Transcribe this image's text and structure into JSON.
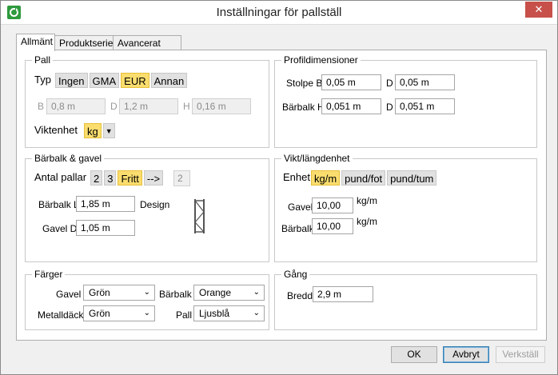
{
  "window": {
    "title": "Inställningar för pallställ",
    "close": "✕"
  },
  "tabs": [
    "Allmänt",
    "Produktserie",
    "Avancerat"
  ],
  "pall": {
    "title": "Pall",
    "typ_label": "Typ",
    "typ_options": [
      "Ingen",
      "GMA",
      "EUR",
      "Annan"
    ],
    "typ_selected": "EUR",
    "b_label": "B",
    "b_value": "0,8 m",
    "d_label": "D",
    "d_value": "1,2 m",
    "h_label": "H",
    "h_value": "0,16 m",
    "viktenhet_label": "Viktenhet",
    "viktenhet_value": "kg"
  },
  "profil": {
    "title": "Profildimensioner",
    "stolpe_label": "Stolpe B",
    "stolpe_b": "0,05 m",
    "stolpe_d_label": "D",
    "stolpe_d": "0,05 m",
    "barbalk_label": "Bärbalk H",
    "barbalk_h": "0,051 m",
    "barbalk_d_label": "D",
    "barbalk_d": "0,051 m"
  },
  "barbalk_gavel": {
    "title": "Bärbalk & gavel",
    "antal_label": "Antal pallar",
    "antal_options": [
      "2",
      "3",
      "Fritt",
      "-->"
    ],
    "antal_selected": "Fritt",
    "antal_value": "2",
    "barbalk_l_label": "Bärbalk L",
    "barbalk_l": "1,85 m",
    "design_label": "Design",
    "gavel_d_label": "Gavel D",
    "gavel_d": "1,05 m"
  },
  "vikt": {
    "title": "Vikt/längdenhet",
    "enhet_label": "Enhet",
    "enhet_options": [
      "kg/m",
      "pund/fot",
      "pund/tum"
    ],
    "enhet_selected": "kg/m",
    "gavel_label": "Gavel",
    "gavel_value": "10,00",
    "gavel_unit": "kg/m",
    "barbalk_label": "Bärbalk",
    "barbalk_value": "10,00",
    "barbalk_unit": "kg/m"
  },
  "farger": {
    "title": "Färger",
    "gavel_label": "Gavel",
    "gavel_value": "Grön",
    "barbalk_label": "Bärbalk",
    "barbalk_value": "Orange",
    "metalldack_label": "Metalldäck",
    "metalldack_value": "Grön",
    "pall_label": "Pall",
    "pall_value": "Ljusblå"
  },
  "gang": {
    "title": "Gång",
    "bredd_label": "Bredd",
    "bredd_value": "2,9 m"
  },
  "buttons": {
    "ok": "OK",
    "avbryt": "Avbryt",
    "verkstall": "Verkställ"
  },
  "colors": {
    "selected_segment": "#fadd6e",
    "close_button": "#c7504a",
    "app_icon": "#2e9a3e"
  }
}
